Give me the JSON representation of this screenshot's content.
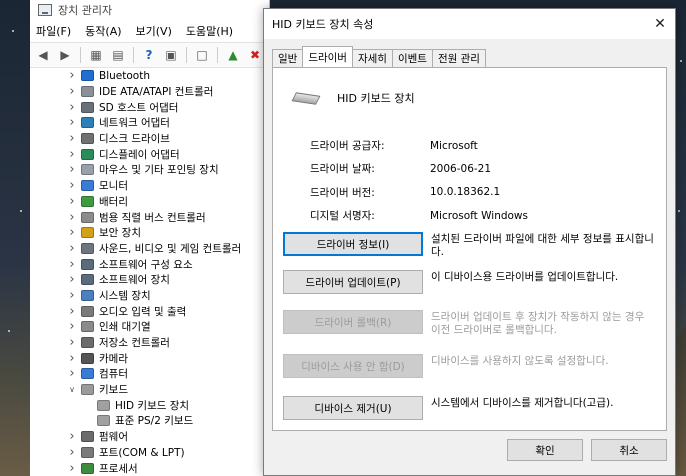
{
  "devmgr": {
    "title": "장치 관리자",
    "menu": [
      "파일(F)",
      "동작(A)",
      "보기(V)",
      "도움말(H)"
    ],
    "tree": [
      {
        "label": "Bluetooth",
        "color": "#1f6fd1",
        "type": "category"
      },
      {
        "label": "IDE ATA/ATAPI 컨트롤러",
        "color": "#8a8f99",
        "type": "category"
      },
      {
        "label": "SD 호스트 어댑터",
        "color": "#6a6f79",
        "type": "category"
      },
      {
        "label": "네트워크 어댑터",
        "color": "#2c7fb8",
        "type": "category"
      },
      {
        "label": "디스크 드라이브",
        "color": "#707070",
        "type": "category"
      },
      {
        "label": "디스플레이 어댑터",
        "color": "#2b8c5a",
        "type": "category"
      },
      {
        "label": "마우스 및 기타 포인팅 장치",
        "color": "#9aa0a8",
        "type": "category"
      },
      {
        "label": "모니터",
        "color": "#3a7bd5",
        "type": "category"
      },
      {
        "label": "배터리",
        "color": "#3f9b3f",
        "type": "category"
      },
      {
        "label": "범용 직렬 버스 컨트롤러",
        "color": "#8c8c8c",
        "type": "category"
      },
      {
        "label": "보안 장치",
        "color": "#d4a017",
        "type": "category"
      },
      {
        "label": "사운드, 비디오 및 게임 컨트롤러",
        "color": "#6e7580",
        "type": "category"
      },
      {
        "label": "소프트웨어 구성 요소",
        "color": "#5a6b7c",
        "type": "category"
      },
      {
        "label": "소프트웨어 장치",
        "color": "#5a6b7c",
        "type": "category"
      },
      {
        "label": "시스템 장치",
        "color": "#4a7fc1",
        "type": "category"
      },
      {
        "label": "오디오 입력 및 출력",
        "color": "#7a7a7a",
        "type": "category"
      },
      {
        "label": "인쇄 대기열",
        "color": "#8a8a8a",
        "type": "category"
      },
      {
        "label": "저장소 컨트롤러",
        "color": "#6b6b6b",
        "type": "category"
      },
      {
        "label": "카메라",
        "color": "#555555",
        "type": "category"
      },
      {
        "label": "컴퓨터",
        "color": "#3a7bd5",
        "type": "category"
      },
      {
        "label": "키보드",
        "color": "#9a9a9a",
        "type": "expanded"
      },
      {
        "label": "HID 키보드 장치",
        "color": "#a0a0a0",
        "type": "child"
      },
      {
        "label": "표준 PS/2 키보드",
        "color": "#a0a0a0",
        "type": "child"
      },
      {
        "label": "펌웨어",
        "color": "#6b6b6b",
        "type": "category"
      },
      {
        "label": "포트(COM & LPT)",
        "color": "#7a7a7a",
        "type": "category"
      },
      {
        "label": "프로세서",
        "color": "#3f8c3f",
        "type": "category"
      }
    ]
  },
  "dialog": {
    "title": "HID 키보드 장치 속성",
    "tabs": [
      "일반",
      "드라이버",
      "자세히",
      "이벤트",
      "전원 관리"
    ],
    "device_name": "HID 키보드 장치",
    "info": [
      {
        "label": "드라이버 공급자:",
        "value": "Microsoft"
      },
      {
        "label": "드라이버 날짜:",
        "value": "2006-06-21"
      },
      {
        "label": "드라이버 버전:",
        "value": "10.0.18362.1"
      },
      {
        "label": "디지털 서명자:",
        "value": "Microsoft Windows"
      }
    ],
    "actions": [
      {
        "label": "드라이버 정보(I)",
        "desc": "설치된 드라이버 파일에 대한 세부 정보를 표시합니다.",
        "disabled": false,
        "focused": true
      },
      {
        "label": "드라이버 업데이트(P)",
        "desc": "이 디바이스용 드라이버를 업데이트합니다.",
        "disabled": false,
        "focused": false
      },
      {
        "label": "드라이버 롤백(R)",
        "desc": "드라이버 업데이트 후 장치가 작동하지 않는 경우 이전 드라이버로 롤백합니다.",
        "disabled": true,
        "focused": false
      },
      {
        "label": "디바이스 사용 안 함(D)",
        "desc": "디바이스를 사용하지 않도록 설정합니다.",
        "disabled": true,
        "focused": false
      },
      {
        "label": "디바이스 제거(U)",
        "desc": "시스템에서 디바이스를 제거합니다(고급).",
        "disabled": false,
        "focused": false
      }
    ],
    "ok_label": "확인",
    "cancel_label": "취소"
  }
}
